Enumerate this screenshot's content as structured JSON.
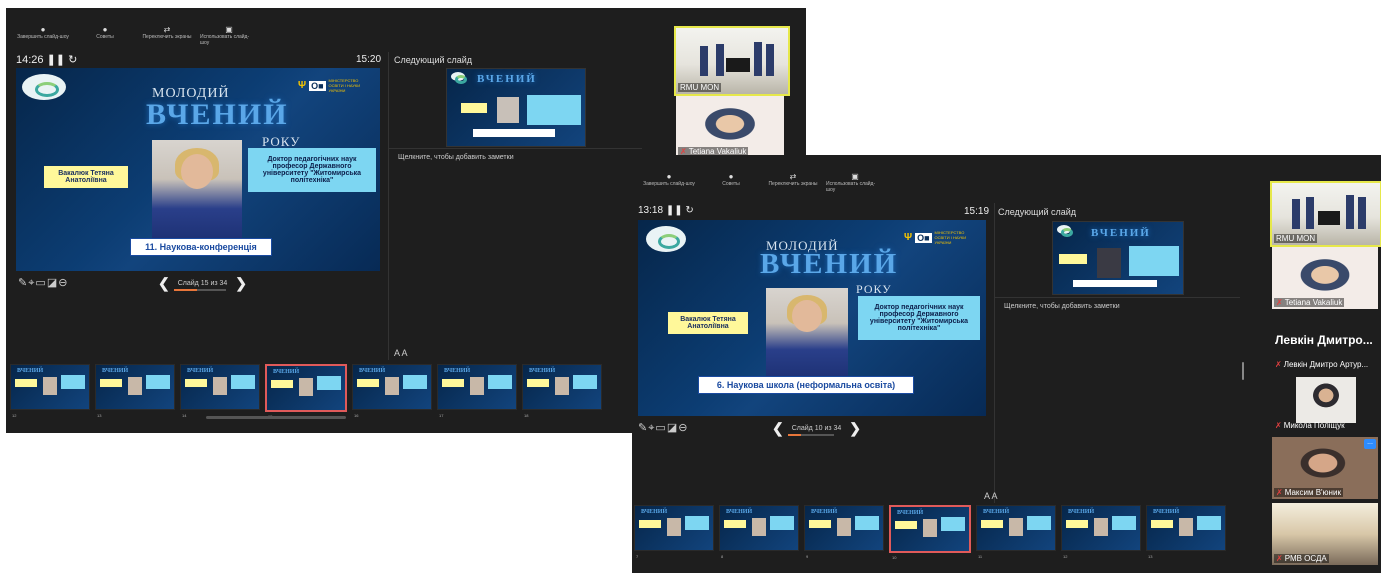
{
  "toolbar": {
    "items": [
      {
        "label": "Завершить слайд-шоу",
        "icon": "stop-icon"
      },
      {
        "label": "Советы",
        "icon": "info-icon"
      },
      {
        "label": "Переключить экраны",
        "icon": "swap-icon"
      },
      {
        "label": "Использовать слайд-шоу",
        "icon": "slideshow-icon"
      }
    ]
  },
  "window1": {
    "timer": "14:26",
    "clock": "15:20",
    "next_slide_label": "Следующий слайд",
    "notes_placeholder": "Щелкните, чтобы добавить заметки",
    "slide": {
      "title_top": "МОЛОДИЙ",
      "title_main": "ВЧЕНИЙ",
      "title_bottom": "РОКУ",
      "ministry": "МІНІСТЕРСТВО ОСВІТИ І НАУКИ УКРАЇНИ",
      "name": "Вакалюк Тетяна Анатоліївна",
      "degree": "Доктор педагогічних наук професор Державного університету \"Житомирська політехніка\"",
      "banner": "11. Наукова-конференція"
    },
    "nav": {
      "slide_counter": "Слайд 15 из 34",
      "progress": 0.44
    },
    "thumbnails": [
      "12",
      "13",
      "14",
      "15",
      "16",
      "17",
      "18"
    ],
    "participants": [
      {
        "name": "RMU MON"
      },
      {
        "name": "Tetiana Vakaliuk"
      }
    ]
  },
  "window2": {
    "timer": "13:18",
    "clock": "15:19",
    "next_slide_label": "Следующий слайд",
    "notes_placeholder": "Щелкните, чтобы добавить заметки",
    "slide": {
      "title_top": "МОЛОДИЙ",
      "title_main": "ВЧЕНИЙ",
      "title_bottom": "РОКУ",
      "ministry": "МІНІСТЕРСТВО ОСВІТИ І НАУКИ УКРАЇНИ",
      "name": "Вакалюк Тетяна Анатоліївна",
      "degree": "Доктор педагогічних наук професор Державного університету \"Житомирська політехніка\"",
      "banner": "6. Наукова школа (неформальна освіта)"
    },
    "nav": {
      "slide_counter": "Слайд 10 из 34",
      "progress": 0.29
    },
    "thumbnails": [
      "7",
      "8",
      "9",
      "10",
      "11",
      "12",
      "13"
    ],
    "participants": [
      {
        "name": "RMU MON"
      },
      {
        "name": "Tetiana Vakaliuk"
      },
      {
        "name": "Левкін Дмитро Артур..."
      },
      {
        "name": "Микола Поліщук"
      },
      {
        "name": "Максим В'юник"
      },
      {
        "name": "РМВ ОСДА"
      }
    ],
    "highlight_name": "Левкін Дмитро...",
    "more_label": "..."
  },
  "colors": {
    "background": "#1e1e1e",
    "slide_blue": "#0c3d73",
    "name_box": "#fff89a",
    "degree_box": "#7dd6f2",
    "active_thumb_border": "#e05a5a",
    "progress_fill": "#e8763a"
  }
}
